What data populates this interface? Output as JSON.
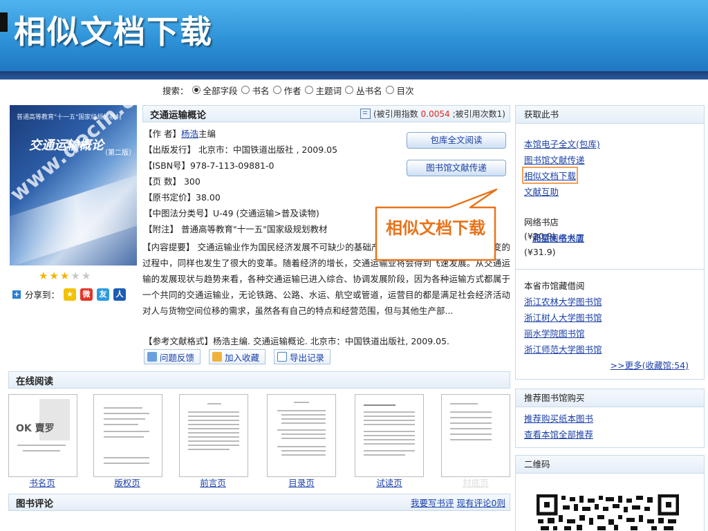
{
  "slide_title": "相似文档下载",
  "search": {
    "label": "搜索：",
    "options": [
      "全部字段",
      "书名",
      "作者",
      "主题词",
      "丛书名",
      "目次"
    ],
    "selected": "全部字段"
  },
  "cover": {
    "top_text": "普通高等教育\"十一五\"国家级规划教材",
    "title": "交通运输概论",
    "edition": "（第二版）",
    "watermark": "www.docin.com"
  },
  "rating": {
    "filled": 3,
    "total": 5
  },
  "share": {
    "label": "分享到：",
    "targets": [
      "qzone-icon",
      "weibo-icon",
      "pengyou-icon",
      "renren-icon"
    ]
  },
  "book": {
    "title": "交通运输概论",
    "cite_prefix": "(被引用指数",
    "cite_index": "0.0054",
    "cite_suffix": ";被引用次数1)",
    "author_label": "【作 者】",
    "author_name": "杨浩",
    "author_role": "主编",
    "publisher": "【出版发行】 北京市：中国铁道出版社 , 2009.05",
    "isbn": "【ISBN号】978-7-113-09881-0",
    "pages": "【页 数】 300",
    "price": "【原书定价】38.00",
    "clc": "【中图法分类号】U-49 (交通运输>普及读物)",
    "note": "【附注】 普通高等教育\"十一五\"国家级规划教材",
    "summary": "【内容提要】 交通运输业作为国民经济发展不可缺少的基础产业，在我国经济向市场经济转变的过程中，同样也发生了很大的变革。随着经济的增长，交通运输业将会得到飞速发展。从交通运输的发展现状与趋势来看，各种交通运输已进入综合、协调发展阶段，因为各种运输方式都属于一个共同的交通运输业，无论铁路、公路、水运、航空或管道，运营目的都是满足社会经济活动对人与货物空间位移的需求，虽然各有自己的特点和经营范围，但与其他生产部...",
    "reference": "【参考文献格式】杨浩主编. 交通运输概论. 北京市：中国铁道出版社, 2009.05."
  },
  "buttons": {
    "full_read": "包库全文阅读",
    "doc_delivery": "图书馆文献传递",
    "feedback": "问题反馈",
    "favorite": "加入收藏",
    "export": "导出记录"
  },
  "callout": "相似文档下载",
  "online_read": {
    "title": "在线阅读",
    "pages": [
      "书名页",
      "版权页",
      "前言页",
      "目录页",
      "试读页",
      "封底页"
    ]
  },
  "reviews": {
    "title": "图书评论",
    "write_link": "我要写书评",
    "count_link": "现有评论0则"
  },
  "sidebar": {
    "get_book": {
      "title": "获取此书",
      "links": [
        "本馆电子全文(包库)",
        "图书馆文献传递",
        "相似文档下载",
        "文献互助"
      ]
    },
    "bookstore": {
      "title": "网络书店",
      "store1": "蔚蓝网络书店",
      "price1": "(¥20.9)",
      "store2": "北京图书大厦",
      "price2": "(¥31.9)"
    },
    "libraries": {
      "title": "本省市馆藏借阅",
      "links": [
        "浙江农林大学图书馆",
        "浙江树人大学图书馆",
        "丽水学院图书馆",
        "浙江师范大学图书馆"
      ],
      "more": ">>更多(收藏馆:54)"
    },
    "recommend": {
      "title": "推荐图书馆购买",
      "links": [
        "推荐购买纸本图书",
        "查看本馆全部推荐"
      ]
    },
    "qrcode": {
      "title": "二维码"
    }
  }
}
